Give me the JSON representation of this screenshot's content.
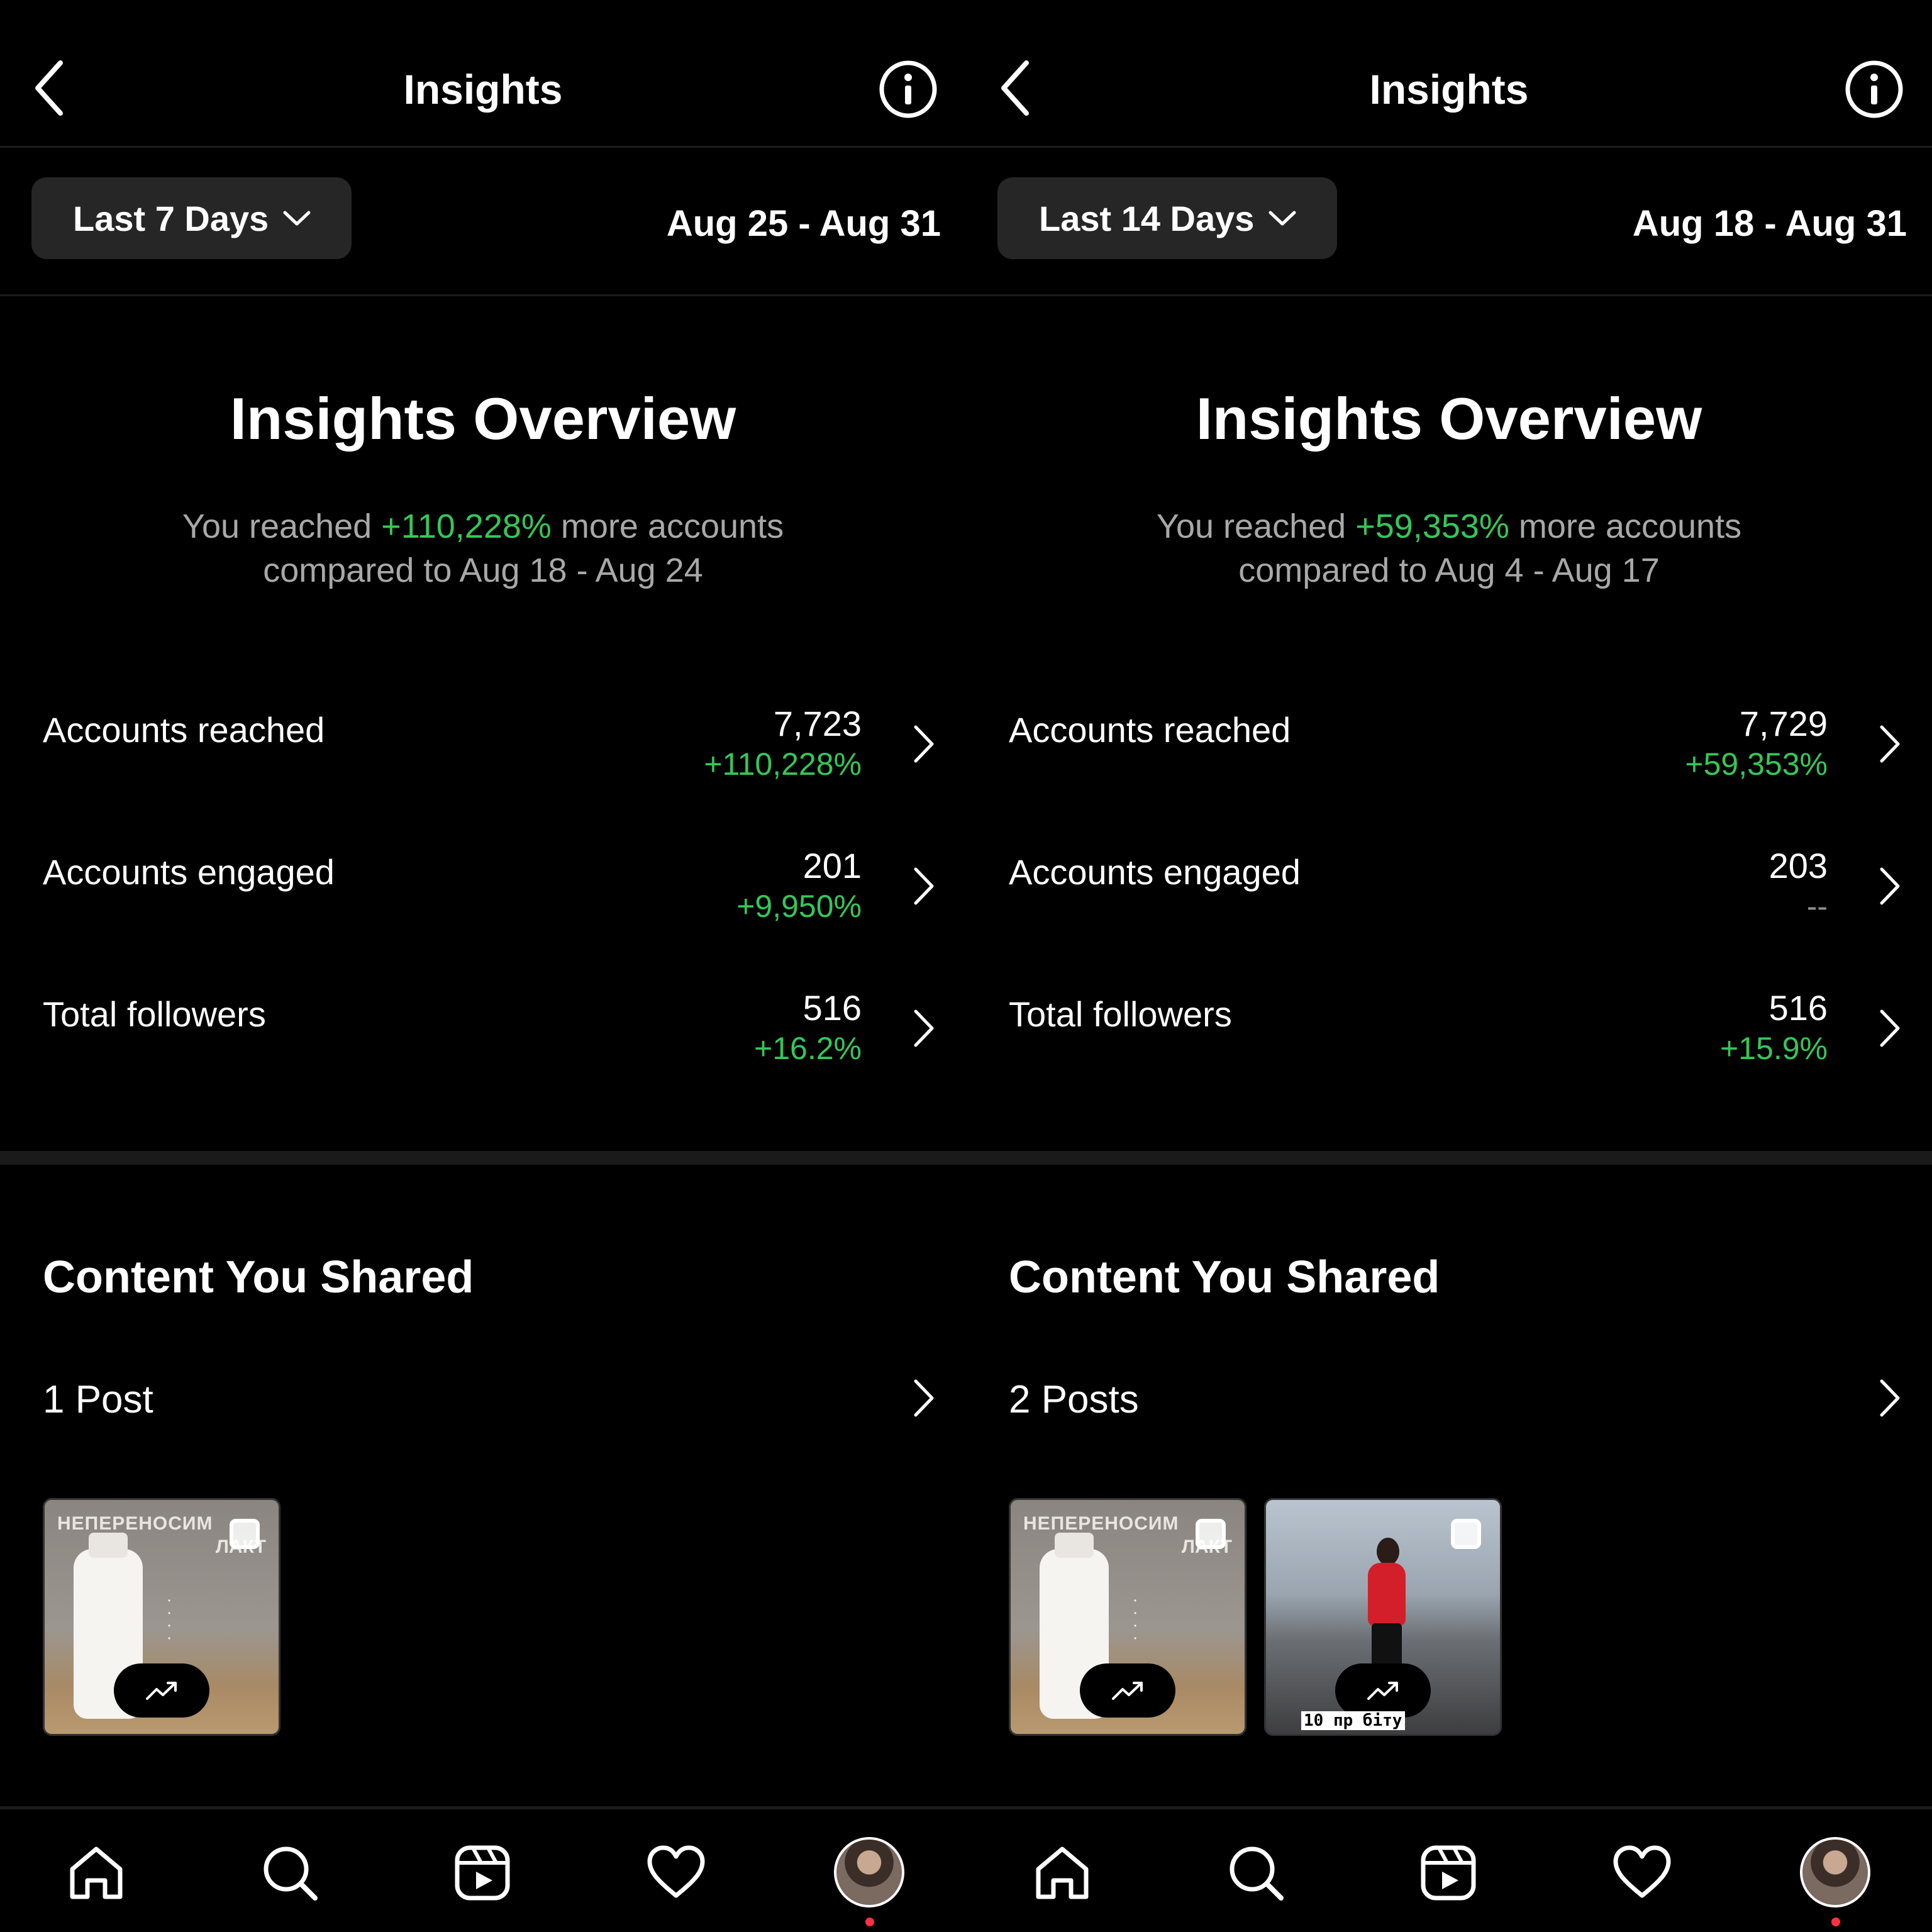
{
  "colors": {
    "background": "#000000",
    "positive": "#34c759",
    "muted": "#a8a8a8",
    "button_bg": "#262626",
    "notification_dot": "#ff3040"
  },
  "panels": [
    {
      "header": {
        "title": "Insights",
        "back_icon": "chevron-left-icon",
        "info_icon": "info-icon"
      },
      "range": {
        "label": "Last 7 Days",
        "dates": "Aug 25 - Aug 31"
      },
      "overview": {
        "title": "Insights Overview",
        "text_before": "You reached ",
        "pct": "+110,228%",
        "text_after": " more accounts",
        "line2": "compared to Aug 18 - Aug 24"
      },
      "metrics": [
        {
          "label": "Accounts reached",
          "value": "7,723",
          "delta": "+110,228%"
        },
        {
          "label": "Accounts engaged",
          "value": "201",
          "delta": "+9,950%"
        },
        {
          "label": "Total followers",
          "value": "516",
          "delta": "+16.2%"
        }
      ],
      "content": {
        "title": "Content You Shared",
        "posts_label": "1 Post",
        "thumbs": [
          {
            "line1": "НЕПЕРЕНОСИМ",
            "line2": "ЛАКТ"
          }
        ]
      }
    },
    {
      "header": {
        "title": "Insights",
        "back_icon": "chevron-left-icon",
        "info_icon": "info-icon"
      },
      "range": {
        "label": "Last 14 Days",
        "dates": "Aug 18 - Aug 31"
      },
      "overview": {
        "title": "Insights Overview",
        "text_before": "You reached ",
        "pct": "+59,353%",
        "text_after": " more accounts",
        "line2": "compared to Aug 4 - Aug 17"
      },
      "metrics": [
        {
          "label": "Accounts reached",
          "value": "7,729",
          "delta": "+59,353%"
        },
        {
          "label": "Accounts engaged",
          "value": "203",
          "delta": "--"
        },
        {
          "label": "Total followers",
          "value": "516",
          "delta": "+15.9%"
        }
      ],
      "content": {
        "title": "Content You Shared",
        "posts_label": "2 Posts",
        "thumbs": [
          {
            "line1": "НЕПЕРЕНОСИМ",
            "line2": "ЛАКТ"
          },
          {
            "caption": "10 пр    біту"
          }
        ]
      }
    }
  ],
  "nav": [
    "home-icon",
    "search-icon",
    "reels-icon",
    "heart-icon",
    "profile-avatar"
  ]
}
